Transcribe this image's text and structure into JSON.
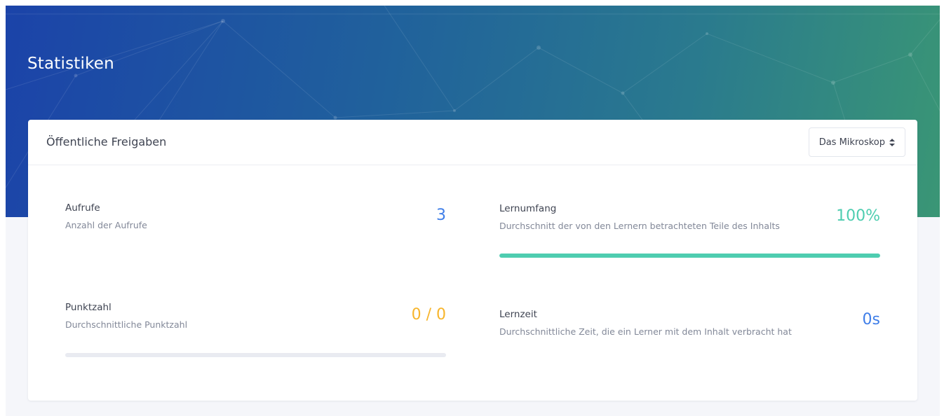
{
  "page": {
    "title": "Statistiken"
  },
  "card": {
    "title": "Öffentliche Freigaben",
    "selector": {
      "value": "Das Mikroskop",
      "icon": "sort-icon"
    }
  },
  "stats": {
    "views": {
      "title": "Aufrufe",
      "description": "Anzahl der Aufrufe",
      "value": "3",
      "color": "#3f7ee8"
    },
    "coverage": {
      "title": "Lernumfang",
      "description": "Durchschnitt der von den Lernern betrachteten Teile des Inhalts",
      "value": "100%",
      "progress": 1.0,
      "color": "#4ecdb0"
    },
    "score": {
      "title": "Punktzahl",
      "description": "Durchschnittliche Punktzahl",
      "value": "0 / 0",
      "progress": 0,
      "color": "#f7b52c"
    },
    "time": {
      "title": "Lernzeit",
      "description": "Durchschnittliche Zeit, die ein Lerner mit dem Inhalt verbracht hat",
      "value": "0s",
      "color": "#3f7ee8"
    }
  }
}
